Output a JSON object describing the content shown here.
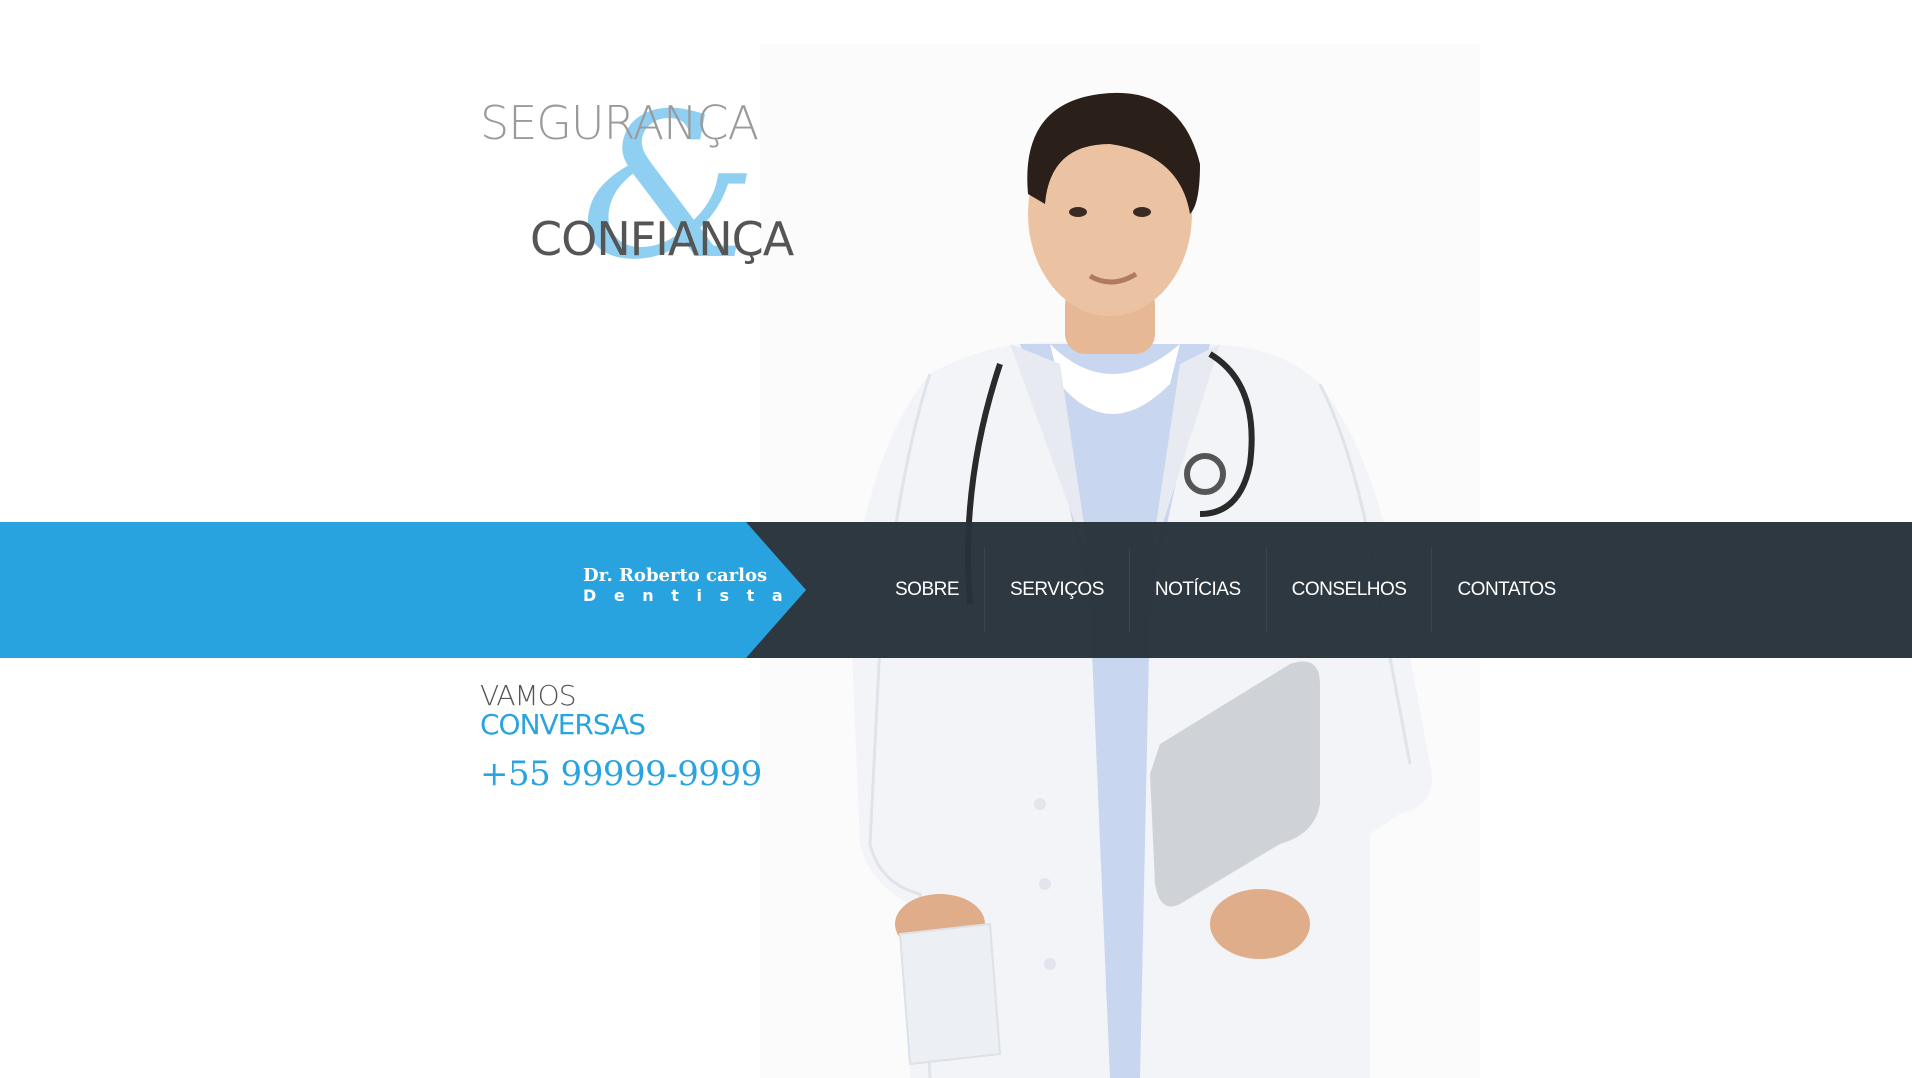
{
  "hero": {
    "line1": "SEGURANÇA",
    "ampersand": "&",
    "line2": "CONFIANÇA"
  },
  "brand": {
    "name": "Dr. Roberto carlos",
    "role": "D e n t i s t a"
  },
  "nav": {
    "items": [
      {
        "label": "SOBRE"
      },
      {
        "label": "SERVIÇOS"
      },
      {
        "label": "NOTÍCIAS"
      },
      {
        "label": "CONSELHOS"
      },
      {
        "label": "CONTATOS"
      }
    ]
  },
  "contact": {
    "line1": "VAMOS",
    "line2": "CONVERSAS",
    "phone": "+55 99999-9999"
  },
  "colors": {
    "accent": "#29a3e0",
    "band_dark": "#27323a",
    "ampersand": "#8fd0f2"
  }
}
